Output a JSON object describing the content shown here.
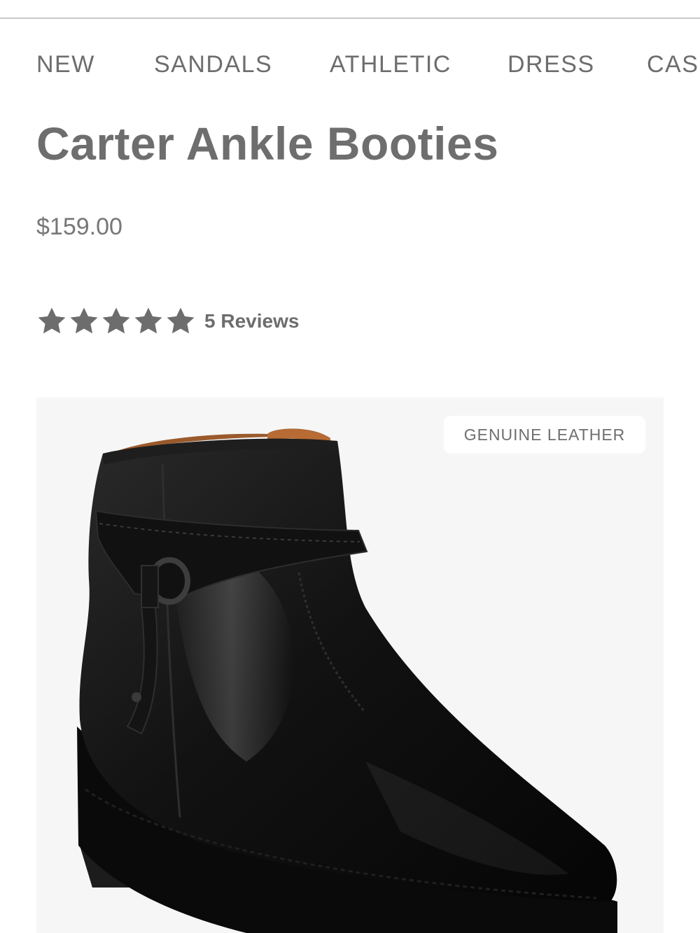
{
  "nav": {
    "items": [
      "NEW",
      "SANDALS",
      "ATHLETIC",
      "DRESS",
      "CAS"
    ]
  },
  "product": {
    "title": "Carter Ankle Booties",
    "price": "$159.00",
    "rating": {
      "stars": 5,
      "max_stars": 5,
      "reviews_label": "5 Reviews"
    },
    "image": {
      "badge": "GENUINE LEATHER",
      "subject": "black leather ankle boot with buckle strap"
    }
  },
  "colors": {
    "text": "#6d6d6d",
    "rule": "#c9c9c9",
    "image_bg": "#f6f6f6",
    "badge_bg": "#ffffff",
    "boot": "#141414"
  },
  "icons": {
    "star": "star-icon"
  }
}
